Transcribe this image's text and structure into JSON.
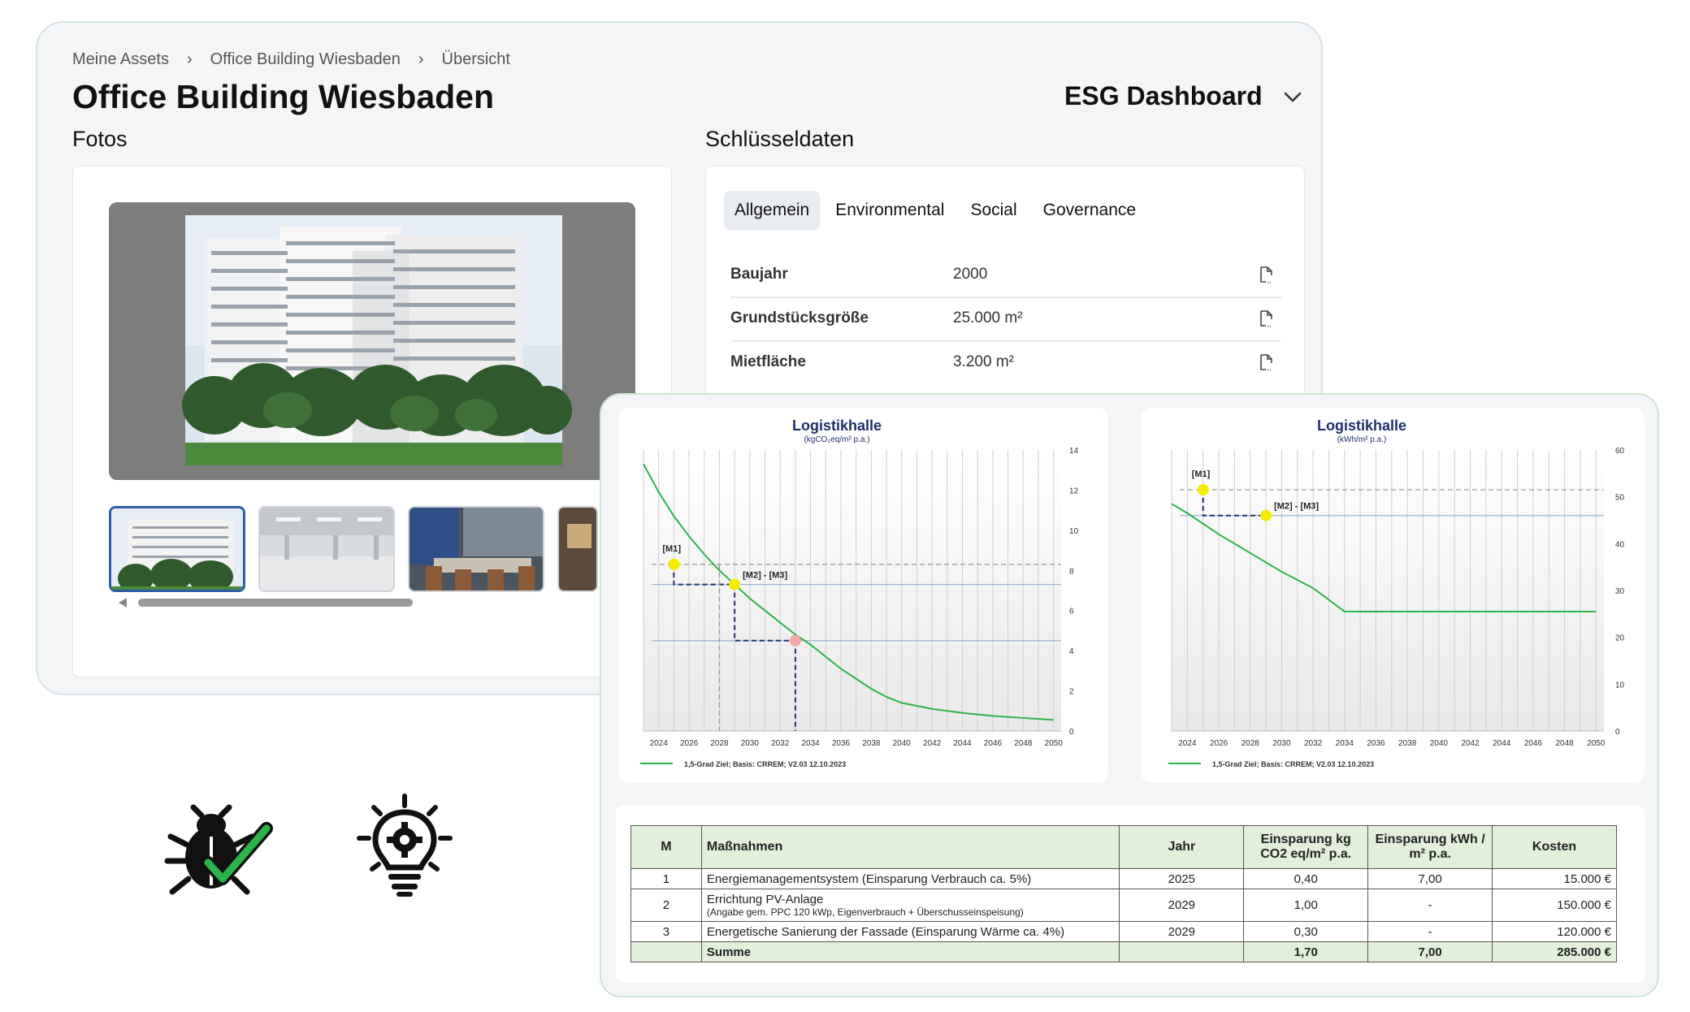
{
  "breadcrumb": [
    "Meine Assets",
    "Office Building Wiesbaden",
    "Übersicht"
  ],
  "page_title": "Office Building Wiesbaden",
  "dashboard_select": "ESG Dashboard",
  "photos": {
    "heading": "Fotos"
  },
  "key_data": {
    "heading": "Schlüsseldaten",
    "tabs": [
      "Allgemein",
      "Environmental",
      "Social",
      "Governance"
    ],
    "rows": [
      {
        "label": "Baujahr",
        "value": "2000"
      },
      {
        "label": "Grundstücksgröße",
        "value": "25.000 m²"
      },
      {
        "label": "Mietfläche",
        "value": "3.200 m²"
      }
    ]
  },
  "chart_data": [
    {
      "type": "line",
      "title": "Logistikhalle",
      "subtitle": "(kgCO₂eq/m² p.a.)",
      "x_ticks": [
        2024,
        2026,
        2028,
        2030,
        2032,
        2034,
        2036,
        2038,
        2040,
        2042,
        2044,
        2046,
        2048,
        2050
      ],
      "y_ticks": [
        0,
        2,
        4,
        6,
        8,
        10,
        12,
        14
      ],
      "ylim": [
        0,
        14
      ],
      "series": [
        {
          "name": "1,5-Grad Ziel; Basis: CRREM; V2.03 12.10.2023",
          "x": [
            2023,
            2024,
            2025,
            2026,
            2027,
            2028,
            2029,
            2030,
            2031,
            2032,
            2033,
            2034,
            2035,
            2036,
            2037,
            2038,
            2039,
            2040,
            2042,
            2044,
            2046,
            2048,
            2050
          ],
          "values": [
            13.3,
            11.9,
            10.7,
            9.7,
            8.8,
            8.0,
            7.3,
            6.6,
            6.0,
            5.4,
            4.8,
            4.3,
            3.7,
            3.1,
            2.6,
            2.1,
            1.7,
            1.4,
            1.1,
            0.9,
            0.75,
            0.65,
            0.55
          ]
        }
      ],
      "markers": [
        {
          "label": "[M1]",
          "x": 2025,
          "y": 8.3,
          "color": "#f5ea00"
        },
        {
          "label": "[M2] - [M3]",
          "x": 2029,
          "y": 7.3,
          "color": "#f5ea00"
        },
        {
          "label": "",
          "x": 2033,
          "y": 4.5,
          "color": "#f0a8a8"
        }
      ],
      "legend": "1,5-Grad Ziel; Basis: CRREM; V2.03 12.10.2023"
    },
    {
      "type": "line",
      "title": "Logistikhalle",
      "subtitle": "(kWh/m² p.a.)",
      "x_ticks": [
        2024,
        2026,
        2028,
        2030,
        2032,
        2034,
        2036,
        2038,
        2040,
        2042,
        2044,
        2046,
        2048,
        2050
      ],
      "y_ticks": [
        0,
        10,
        20,
        30,
        40,
        50,
        60
      ],
      "ylim": [
        0,
        60
      ],
      "series": [
        {
          "name": "1,5-Grad Ziel; Basis: CRREM; V2.03 12.10.2023",
          "x": [
            2023,
            2024,
            2026,
            2028,
            2030,
            2032,
            2034,
            2036,
            2038,
            2040,
            2042,
            2044,
            2046,
            2048,
            2050
          ],
          "values": [
            48.5,
            46.5,
            42.0,
            38.0,
            34.0,
            30.5,
            25.5,
            25.5,
            25.5,
            25.5,
            25.5,
            25.5,
            25.5,
            25.5,
            25.5
          ]
        }
      ],
      "markers": [
        {
          "label": "[M1]",
          "x": 2025,
          "y": 51.5,
          "color": "#f5ea00"
        },
        {
          "label": "[M2] - [M3]",
          "x": 2029,
          "y": 46.0,
          "color": "#f5ea00"
        }
      ],
      "legend": "1,5-Grad Ziel; Basis: CRREM; V2.03 12.10.2023"
    }
  ],
  "measures_table": {
    "headers": [
      "M",
      "Maßnahmen",
      "Jahr",
      "Einsparung kg CO2 eq/m² p.a.",
      "Einsparung kWh / m² p.a.",
      "Kosten"
    ],
    "rows": [
      {
        "m": "1",
        "name": "Energiemanagementsystem (Einsparung Verbrauch ca. 5%)",
        "note": "",
        "year": "2025",
        "co2": "0,40",
        "kwh": "7,00",
        "cost": "15.000 €"
      },
      {
        "m": "2",
        "name": "Errichtung PV-Anlage",
        "note": "(Angabe gem. PPC 120 kWp, Eigenverbrauch + Überschusseinspeisung)",
        "year": "2029",
        "co2": "1,00",
        "kwh": "-",
        "cost": "150.000 €"
      },
      {
        "m": "3",
        "name": "Energetische Sanierung der Fassade (Einsparung Wärme ca. 4%)",
        "note": "",
        "year": "2029",
        "co2": "0,30",
        "kwh": "-",
        "cost": "120.000 €"
      }
    ],
    "sum": {
      "label": "Summe",
      "co2": "1,70",
      "kwh": "7,00",
      "cost": "285.000 €"
    }
  },
  "icons": [
    "bug-check-icon",
    "lightbulb-gear-icon"
  ],
  "colors": {
    "accent_green": "#2db34a",
    "table_header": "#e2efda",
    "navy_dash": "#1f2f6b"
  }
}
